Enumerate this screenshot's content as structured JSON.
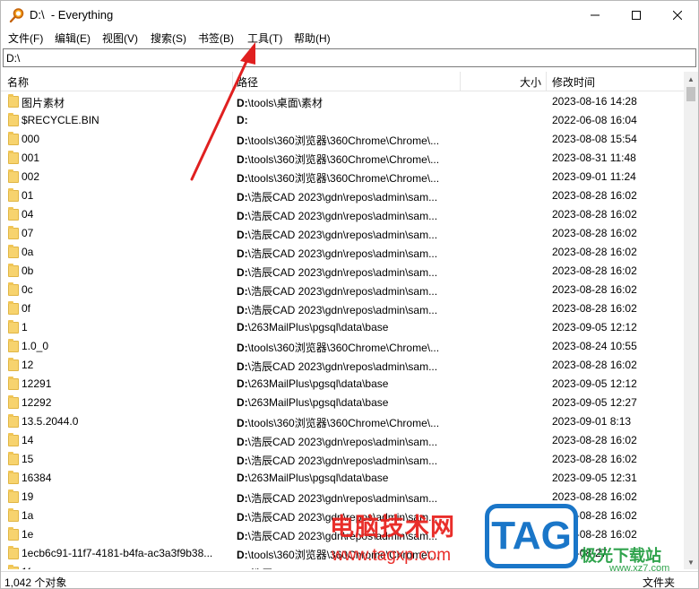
{
  "window": {
    "title": "D:\\  - Everything",
    "minimize_icon": "minimize-icon",
    "maximize_icon": "maximize-icon",
    "close_icon": "close-icon"
  },
  "menu": [
    "文件(F)",
    "编辑(E)",
    "视图(V)",
    "搜索(S)",
    "书签(B)",
    "工具(T)",
    "帮助(H)"
  ],
  "search": {
    "value": "D:\\"
  },
  "columns": {
    "name": "名称",
    "path": "路径",
    "size": "大小",
    "modified": "修改时间"
  },
  "rows": [
    {
      "name": "图片素材",
      "path_bold": "D:",
      "path_rest": "\\tools\\桌面\\素材",
      "date": "2023-08-16 14:28"
    },
    {
      "name": "$RECYCLE.BIN",
      "path_bold": "D:",
      "path_rest": "",
      "date": "2022-06-08 16:04"
    },
    {
      "name": "000",
      "path_bold": "D:",
      "path_rest": "\\tools\\360浏览器\\360Chrome\\Chrome\\...",
      "date": "2023-08-08 15:54"
    },
    {
      "name": "001",
      "path_bold": "D:",
      "path_rest": "\\tools\\360浏览器\\360Chrome\\Chrome\\...",
      "date": "2023-08-31 11:48"
    },
    {
      "name": "002",
      "path_bold": "D:",
      "path_rest": "\\tools\\360浏览器\\360Chrome\\Chrome\\...",
      "date": "2023-09-01 11:24"
    },
    {
      "name": "01",
      "path_bold": "D:",
      "path_rest": "\\浩辰CAD 2023\\gdn\\repos\\admin\\sam...",
      "date": "2023-08-28 16:02"
    },
    {
      "name": "04",
      "path_bold": "D:",
      "path_rest": "\\浩辰CAD 2023\\gdn\\repos\\admin\\sam...",
      "date": "2023-08-28 16:02"
    },
    {
      "name": "07",
      "path_bold": "D:",
      "path_rest": "\\浩辰CAD 2023\\gdn\\repos\\admin\\sam...",
      "date": "2023-08-28 16:02"
    },
    {
      "name": "0a",
      "path_bold": "D:",
      "path_rest": "\\浩辰CAD 2023\\gdn\\repos\\admin\\sam...",
      "date": "2023-08-28 16:02"
    },
    {
      "name": "0b",
      "path_bold": "D:",
      "path_rest": "\\浩辰CAD 2023\\gdn\\repos\\admin\\sam...",
      "date": "2023-08-28 16:02"
    },
    {
      "name": "0c",
      "path_bold": "D:",
      "path_rest": "\\浩辰CAD 2023\\gdn\\repos\\admin\\sam...",
      "date": "2023-08-28 16:02"
    },
    {
      "name": "0f",
      "path_bold": "D:",
      "path_rest": "\\浩辰CAD 2023\\gdn\\repos\\admin\\sam...",
      "date": "2023-08-28 16:02"
    },
    {
      "name": "1",
      "path_bold": "D:",
      "path_rest": "\\263MailPlus\\pgsql\\data\\base",
      "date": "2023-09-05 12:12"
    },
    {
      "name": "1.0_0",
      "path_bold": "D:",
      "path_rest": "\\tools\\360浏览器\\360Chrome\\Chrome\\...",
      "date": "2023-08-24 10:55"
    },
    {
      "name": "12",
      "path_bold": "D:",
      "path_rest": "\\浩辰CAD 2023\\gdn\\repos\\admin\\sam...",
      "date": "2023-08-28 16:02"
    },
    {
      "name": "12291",
      "path_bold": "D:",
      "path_rest": "\\263MailPlus\\pgsql\\data\\base",
      "date": "2023-09-05 12:12"
    },
    {
      "name": "12292",
      "path_bold": "D:",
      "path_rest": "\\263MailPlus\\pgsql\\data\\base",
      "date": "2023-09-05 12:27"
    },
    {
      "name": "13.5.2044.0",
      "path_bold": "D:",
      "path_rest": "\\tools\\360浏览器\\360Chrome\\Chrome\\...",
      "date": "2023-09-01 8:13"
    },
    {
      "name": "14",
      "path_bold": "D:",
      "path_rest": "\\浩辰CAD 2023\\gdn\\repos\\admin\\sam...",
      "date": "2023-08-28 16:02"
    },
    {
      "name": "15",
      "path_bold": "D:",
      "path_rest": "\\浩辰CAD 2023\\gdn\\repos\\admin\\sam...",
      "date": "2023-08-28 16:02"
    },
    {
      "name": "16384",
      "path_bold": "D:",
      "path_rest": "\\263MailPlus\\pgsql\\data\\base",
      "date": "2023-09-05 12:31"
    },
    {
      "name": "19",
      "path_bold": "D:",
      "path_rest": "\\浩辰CAD 2023\\gdn\\repos\\admin\\sam...",
      "date": "2023-08-28 16:02"
    },
    {
      "name": "1a",
      "path_bold": "D:",
      "path_rest": "\\浩辰CAD 2023\\gdn\\repos\\admin\\sam...",
      "date": "2023-08-28 16:02"
    },
    {
      "name": "1e",
      "path_bold": "D:",
      "path_rest": "\\浩辰CAD 2023\\gdn\\repos\\admin\\sam...",
      "date": "2023-08-28 16:02"
    },
    {
      "name": "1ecb6c91-11f7-4181-b4fa-ac3a3f9b38...",
      "path_bold": "D:",
      "path_rest": "\\tools\\360浏览器\\360Chrome\\Chrome\\...",
      "date": "2023-08-27"
    },
    {
      "name": "1f",
      "path_bold": "D:",
      "path_rest": "\\浩辰CAD 2023\\gdn\\repos\\admin\\sam...",
      "date": ""
    }
  ],
  "status": {
    "count": "1,042 个对象",
    "right": "文件夹"
  },
  "watermark": {
    "text1": "电脑技术网",
    "url": "www.tagxp.com",
    "logo": "TAG",
    "text2": "极光下载站",
    "url2": "www.xz7.com"
  },
  "colors": {
    "arrow": "#e02020",
    "watermark_red": "#e8231f",
    "logo_blue": "#1a76c8"
  }
}
